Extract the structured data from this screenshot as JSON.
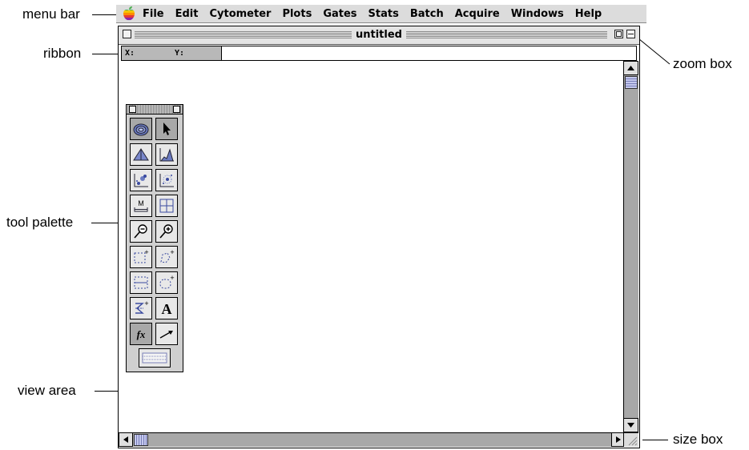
{
  "callouts": {
    "menu_bar": "menu bar",
    "ribbon": "ribbon",
    "tool_palette": "tool palette",
    "view_area": "view area",
    "zoom_box": "zoom box",
    "size_box": "size box"
  },
  "menubar": {
    "apple_icon": "apple-menu-icon",
    "items": [
      "File",
      "Edit",
      "Cytometer",
      "Plots",
      "Gates",
      "Stats",
      "Batch",
      "Acquire",
      "Windows",
      "Help"
    ]
  },
  "window": {
    "title": "untitled"
  },
  "ribbon": {
    "x_label": "X:",
    "y_label": "Y:"
  },
  "palette": {
    "text_tool_glyph": "A",
    "function_tool_glyph": "fx",
    "marker_tool_glyph": "M"
  },
  "colors": {
    "selection_gray": "#a8a8a8",
    "scroll_thumb": "#c4c8ee",
    "apple_logo": [
      "#4caf50",
      "#f5c400",
      "#ff8c00",
      "#e53935",
      "#8e24aa",
      "#1e88e5"
    ]
  }
}
